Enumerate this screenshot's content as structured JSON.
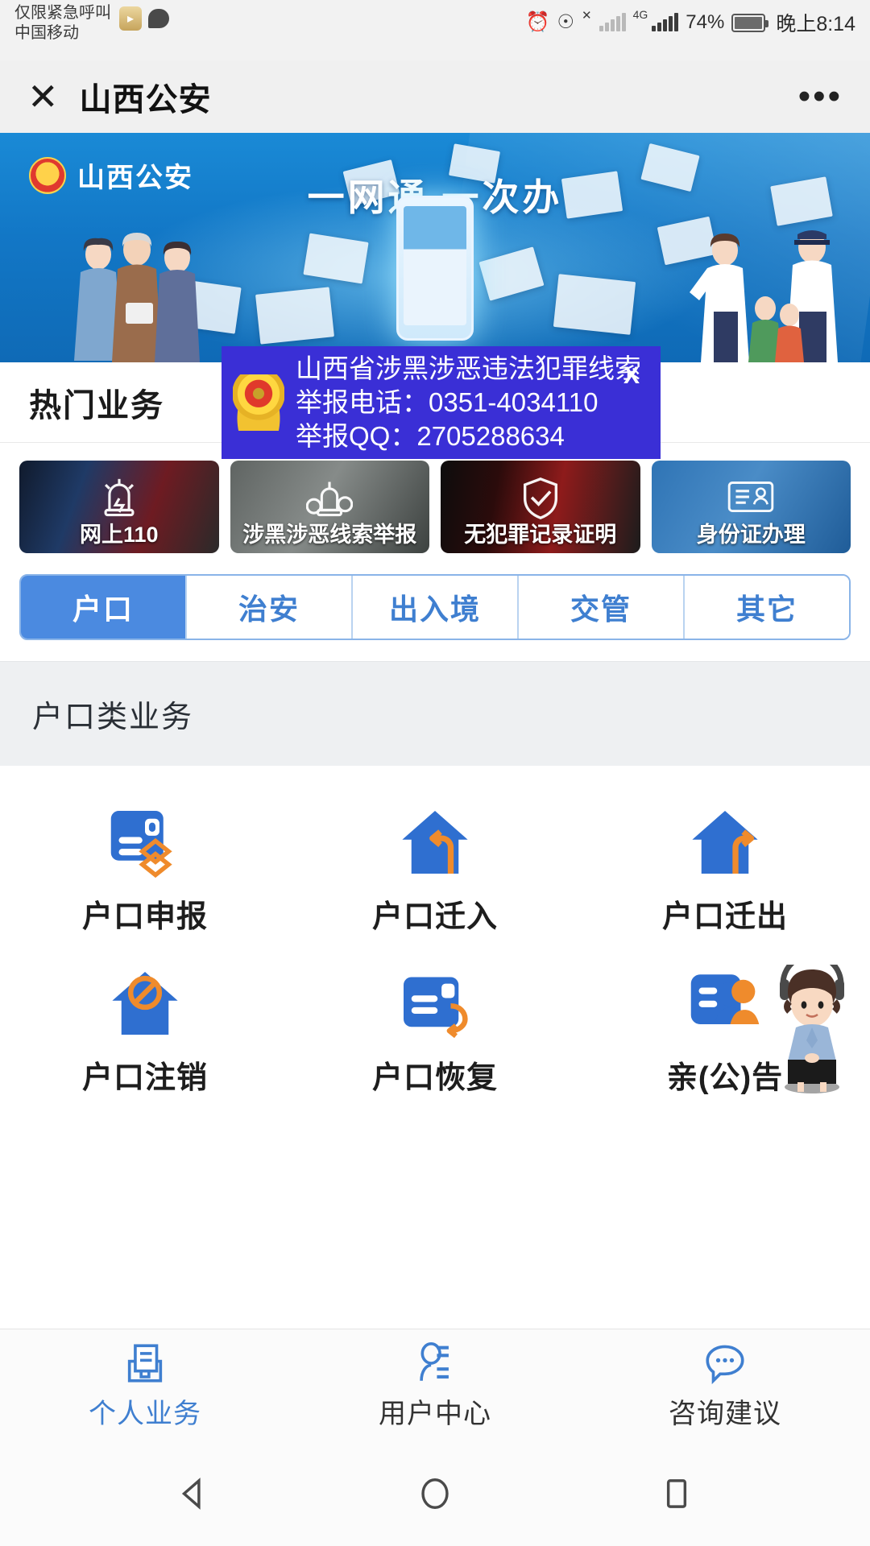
{
  "status_bar": {
    "carrier_line1": "仅限紧急呼叫",
    "carrier_line2": "中国移动",
    "network_type": "4G",
    "battery_percent": "74%",
    "time": "晚上8:14",
    "icons": [
      "alarm-icon",
      "eye-icon",
      "no-signal-icon",
      "signal-bars-icon",
      "battery-icon"
    ]
  },
  "title_bar": {
    "close_label": "✕",
    "title": "山西公安",
    "more_label": "•••"
  },
  "banner": {
    "logo_text": "山西公安",
    "slogan": "一网通 一次办",
    "badge_icon": "police-badge-icon"
  },
  "popup": {
    "line1": "山西省涉黑涉恶违法犯罪线索",
    "line2": "举报电话：0351-4034110",
    "line3": "举报QQ：2705288634",
    "close_label": "X",
    "bg_color": "#3a2fd6",
    "emblem_icon": "police-emblem-icon"
  },
  "hot_section": {
    "title": "热门业务",
    "cards": [
      {
        "label": "网上110",
        "icon": "police-siren-icon"
      },
      {
        "label": "涉黑涉恶线索举报",
        "icon": "handcuffs-siren-icon"
      },
      {
        "label": "无犯罪记录证明",
        "icon": "shield-check-icon"
      },
      {
        "label": "身份证办理",
        "icon": "id-card-icon"
      }
    ]
  },
  "tabs": {
    "items": [
      {
        "label": "户口",
        "active": true
      },
      {
        "label": "治安",
        "active": false
      },
      {
        "label": "出入境",
        "active": false
      },
      {
        "label": "交管",
        "active": false
      },
      {
        "label": "其它",
        "active": false
      }
    ],
    "active_bg": "#4b8ae0",
    "text_color": "#3f7fd0"
  },
  "category": {
    "title": "户口类业务",
    "items": [
      {
        "label": "户口申报",
        "icon": "card-layers-icon"
      },
      {
        "label": "户口迁入",
        "icon": "house-arrow-in-icon"
      },
      {
        "label": "户口迁出",
        "icon": "house-arrow-out-icon"
      },
      {
        "label": "户口注销",
        "icon": "house-ban-icon"
      },
      {
        "label": "户口恢复",
        "icon": "card-return-icon"
      },
      {
        "label": "亲(公)告",
        "icon": "card-person-icon"
      }
    ]
  },
  "assistant": {
    "icon": "police-assistant-avatar"
  },
  "bottom_nav": {
    "items": [
      {
        "label": "个人业务",
        "icon": "briefcase-doc-icon",
        "active": true
      },
      {
        "label": "用户中心",
        "icon": "user-list-icon",
        "active": false
      },
      {
        "label": "咨询建议",
        "icon": "chat-bubble-icon",
        "active": false
      }
    ]
  },
  "android_nav": {
    "back": "back-triangle-icon",
    "home": "home-circle-icon",
    "recents": "recents-square-icon"
  }
}
